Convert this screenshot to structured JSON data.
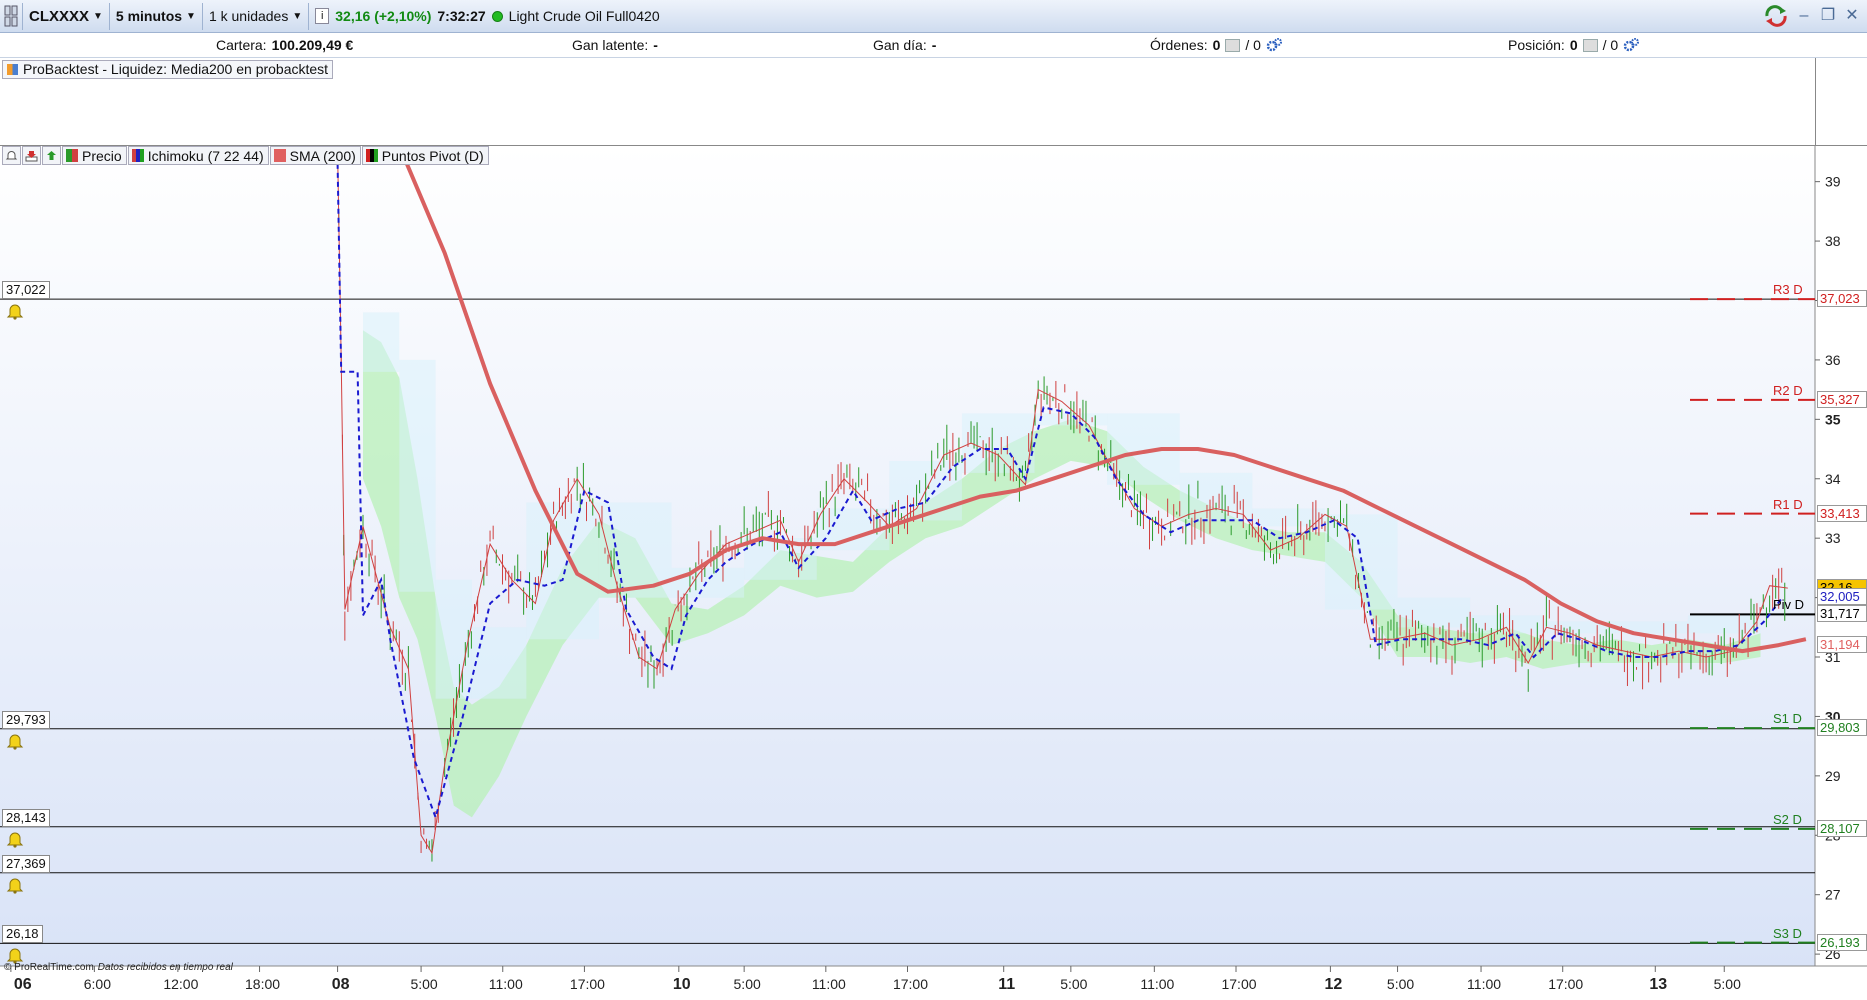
{
  "toolbar": {
    "symbol": "CLXXXX",
    "timeframe": "5 minutos",
    "units": "1 k unidades",
    "price_change": "32,16 (+2,10%)",
    "time": "7:32:27",
    "instrument": "Light Crude Oil Full0420"
  },
  "account": {
    "cartera_label": "Cartera:",
    "cartera_value": "100.209,49 €",
    "gan_latente_label": "Gan latente:",
    "gan_latente_value": "-",
    "gan_dia_label": "Gan día:",
    "gan_dia_value": "-",
    "ordenes_label": "Órdenes:",
    "ordenes_a": "0",
    "ordenes_b": "/ 0",
    "posicion_label": "Posición:",
    "posicion_a": "0",
    "posicion_b": "/ 0"
  },
  "indicator_panel": {
    "label": "ProBacktest - Liquidez: Media200 en probacktest"
  },
  "legend": {
    "items": [
      {
        "label": "Precio",
        "color": "#e06060"
      },
      {
        "label": "Ichimoku (7 22 44)",
        "color": "#2020c0"
      },
      {
        "label": "SMA (200)",
        "color": "#e06060"
      },
      {
        "label": "Puntos Pivot (D)",
        "color": "#000000"
      }
    ]
  },
  "alert_levels": [
    "37,022",
    "29,793",
    "28,143",
    "27,369",
    "26,18"
  ],
  "pivots": [
    {
      "name": "R3 D",
      "value": "37,023",
      "color": "#d02020"
    },
    {
      "name": "R2 D",
      "value": "35,327",
      "color": "#d02020"
    },
    {
      "name": "R1 D",
      "value": "33,413",
      "color": "#d02020"
    },
    {
      "name": "Piv D",
      "value": "31,717",
      "color": "#000000"
    },
    {
      "name": "S1 D",
      "value": "29,803",
      "color": "#208020"
    },
    {
      "name": "S2 D",
      "value": "28,107",
      "color": "#208020"
    },
    {
      "name": "S3 D",
      "value": "26,193",
      "color": "#208020"
    }
  ],
  "price_tags": {
    "last": "32,16",
    "kijun": "32,005",
    "sma": "31,194",
    "last_color": "#f5c400",
    "kijun_color": "#2020c0",
    "sma_color": "#e06060"
  },
  "footer": {
    "credit": "© ProRealTime.com",
    "note": "Datos recibidos en tiempo real"
  },
  "chart_data": {
    "type": "line",
    "y_ticks": [
      "39",
      "38",
      "37",
      "36",
      "35",
      "34",
      "33",
      "32",
      "31",
      "30",
      "29",
      "28",
      "27",
      "26"
    ],
    "x_ticks": [
      "06",
      "6:00",
      "12:00",
      "18:00",
      "08",
      "5:00",
      "11:00",
      "17:00",
      "10",
      "5:00",
      "11:00",
      "17:00",
      "11",
      "5:00",
      "11:00",
      "17:00",
      "12",
      "5:00",
      "11:00",
      "17:00",
      "13",
      "5:00"
    ],
    "x_bold": [
      "06",
      "08",
      "10",
      "11",
      "12",
      "13"
    ],
    "ylim": [
      25.8,
      39.6
    ],
    "price_path": [
      [
        0.186,
        39.5
      ],
      [
        0.188,
        36.0
      ],
      [
        0.19,
        31.8
      ],
      [
        0.2,
        33.2
      ],
      [
        0.215,
        31.5
      ],
      [
        0.225,
        30.8
      ],
      [
        0.232,
        28.0
      ],
      [
        0.238,
        27.7
      ],
      [
        0.245,
        29.2
      ],
      [
        0.258,
        31.3
      ],
      [
        0.27,
        32.9
      ],
      [
        0.282,
        32.3
      ],
      [
        0.295,
        31.9
      ],
      [
        0.305,
        33.3
      ],
      [
        0.318,
        34.0
      ],
      [
        0.33,
        33.4
      ],
      [
        0.34,
        32.2
      ],
      [
        0.352,
        31.0
      ],
      [
        0.362,
        30.8
      ],
      [
        0.372,
        31.8
      ],
      [
        0.385,
        32.4
      ],
      [
        0.4,
        32.9
      ],
      [
        0.415,
        33.1
      ],
      [
        0.43,
        33.3
      ],
      [
        0.44,
        32.6
      ],
      [
        0.452,
        33.4
      ],
      [
        0.465,
        34.0
      ],
      [
        0.478,
        33.6
      ],
      [
        0.49,
        33.2
      ],
      [
        0.505,
        33.5
      ],
      [
        0.52,
        34.4
      ],
      [
        0.535,
        34.6
      ],
      [
        0.55,
        34.4
      ],
      [
        0.565,
        33.9
      ],
      [
        0.572,
        35.5
      ],
      [
        0.585,
        35.3
      ],
      [
        0.6,
        34.9
      ],
      [
        0.612,
        34.2
      ],
      [
        0.625,
        33.5
      ],
      [
        0.64,
        33.2
      ],
      [
        0.655,
        33.4
      ],
      [
        0.67,
        33.5
      ],
      [
        0.685,
        33.4
      ],
      [
        0.7,
        32.8
      ],
      [
        0.715,
        33.0
      ],
      [
        0.73,
        33.4
      ],
      [
        0.742,
        33.2
      ],
      [
        0.755,
        31.3
      ],
      [
        0.768,
        31.3
      ],
      [
        0.785,
        31.4
      ],
      [
        0.8,
        31.2
      ],
      [
        0.815,
        31.3
      ],
      [
        0.83,
        31.5
      ],
      [
        0.842,
        30.9
      ],
      [
        0.852,
        31.5
      ],
      [
        0.865,
        31.4
      ],
      [
        0.88,
        31.2
      ],
      [
        0.895,
        31.1
      ],
      [
        0.91,
        31.0
      ],
      [
        0.925,
        31.1
      ],
      [
        0.94,
        31.0
      ],
      [
        0.955,
        31.1
      ],
      [
        0.968,
        31.6
      ],
      [
        0.975,
        32.2
      ],
      [
        0.985,
        32.16
      ]
    ],
    "kijun_path": [
      [
        0.186,
        39.3
      ],
      [
        0.188,
        35.8
      ],
      [
        0.197,
        35.8
      ],
      [
        0.2,
        31.7
      ],
      [
        0.21,
        32.3
      ],
      [
        0.215,
        31.3
      ],
      [
        0.228,
        29.3
      ],
      [
        0.24,
        28.3
      ],
      [
        0.255,
        30.0
      ],
      [
        0.27,
        31.9
      ],
      [
        0.285,
        32.3
      ],
      [
        0.3,
        32.2
      ],
      [
        0.31,
        32.3
      ],
      [
        0.322,
        33.8
      ],
      [
        0.335,
        33.6
      ],
      [
        0.345,
        31.8
      ],
      [
        0.36,
        31.0
      ],
      [
        0.37,
        30.8
      ],
      [
        0.378,
        31.7
      ],
      [
        0.39,
        32.3
      ],
      [
        0.4,
        32.6
      ],
      [
        0.415,
        32.9
      ],
      [
        0.43,
        33.1
      ],
      [
        0.44,
        32.5
      ],
      [
        0.455,
        33.0
      ],
      [
        0.47,
        33.8
      ],
      [
        0.48,
        33.3
      ],
      [
        0.495,
        33.5
      ],
      [
        0.51,
        33.6
      ],
      [
        0.525,
        34.2
      ],
      [
        0.54,
        34.5
      ],
      [
        0.555,
        34.5
      ],
      [
        0.565,
        34.0
      ],
      [
        0.575,
        35.2
      ],
      [
        0.59,
        35.1
      ],
      [
        0.603,
        34.7
      ],
      [
        0.615,
        34.0
      ],
      [
        0.63,
        33.4
      ],
      [
        0.645,
        33.1
      ],
      [
        0.66,
        33.3
      ],
      [
        0.675,
        33.3
      ],
      [
        0.69,
        33.3
      ],
      [
        0.705,
        33.0
      ],
      [
        0.72,
        33.1
      ],
      [
        0.735,
        33.3
      ],
      [
        0.748,
        33.0
      ],
      [
        0.758,
        31.2
      ],
      [
        0.772,
        31.3
      ],
      [
        0.79,
        31.3
      ],
      [
        0.805,
        31.3
      ],
      [
        0.82,
        31.2
      ],
      [
        0.835,
        31.4
      ],
      [
        0.845,
        31.0
      ],
      [
        0.858,
        31.4
      ],
      [
        0.87,
        31.3
      ],
      [
        0.885,
        31.1
      ],
      [
        0.9,
        31.0
      ],
      [
        0.915,
        31.0
      ],
      [
        0.93,
        31.1
      ],
      [
        0.945,
        31.1
      ],
      [
        0.958,
        31.2
      ],
      [
        0.972,
        31.6
      ],
      [
        0.982,
        32.0
      ]
    ],
    "sma_path": [
      [
        0.22,
        39.6
      ],
      [
        0.245,
        37.8
      ],
      [
        0.27,
        35.6
      ],
      [
        0.295,
        33.8
      ],
      [
        0.318,
        32.4
      ],
      [
        0.335,
        32.1
      ],
      [
        0.36,
        32.2
      ],
      [
        0.38,
        32.4
      ],
      [
        0.4,
        32.8
      ],
      [
        0.42,
        33.0
      ],
      [
        0.44,
        32.9
      ],
      [
        0.46,
        32.9
      ],
      [
        0.48,
        33.1
      ],
      [
        0.5,
        33.3
      ],
      [
        0.52,
        33.5
      ],
      [
        0.54,
        33.7
      ],
      [
        0.56,
        33.8
      ],
      [
        0.58,
        34.0
      ],
      [
        0.6,
        34.2
      ],
      [
        0.62,
        34.4
      ],
      [
        0.64,
        34.5
      ],
      [
        0.66,
        34.5
      ],
      [
        0.68,
        34.4
      ],
      [
        0.7,
        34.2
      ],
      [
        0.72,
        34.0
      ],
      [
        0.74,
        33.8
      ],
      [
        0.76,
        33.5
      ],
      [
        0.78,
        33.2
      ],
      [
        0.8,
        32.9
      ],
      [
        0.82,
        32.6
      ],
      [
        0.84,
        32.3
      ],
      [
        0.86,
        31.9
      ],
      [
        0.88,
        31.6
      ],
      [
        0.9,
        31.4
      ],
      [
        0.92,
        31.3
      ],
      [
        0.94,
        31.2
      ],
      [
        0.96,
        31.1
      ],
      [
        0.98,
        31.2
      ],
      [
        0.995,
        31.3
      ]
    ],
    "cloud_path": [
      [
        0.2,
        36.5
      ],
      [
        0.21,
        36.3
      ],
      [
        0.22,
        35.7
      ],
      [
        0.23,
        34.0
      ],
      [
        0.24,
        32.0
      ],
      [
        0.25,
        30.5
      ],
      [
        0.26,
        30.2
      ],
      [
        0.275,
        30.5
      ],
      [
        0.29,
        31.2
      ],
      [
        0.31,
        32.5
      ],
      [
        0.33,
        33.3
      ],
      [
        0.35,
        33.0
      ],
      [
        0.37,
        31.9
      ],
      [
        0.39,
        31.8
      ],
      [
        0.41,
        32.2
      ],
      [
        0.43,
        32.8
      ],
      [
        0.45,
        32.7
      ],
      [
        0.47,
        32.6
      ],
      [
        0.49,
        33.2
      ],
      [
        0.51,
        33.6
      ],
      [
        0.53,
        34.0
      ],
      [
        0.55,
        34.5
      ],
      [
        0.57,
        34.8
      ],
      [
        0.59,
        35.0
      ],
      [
        0.61,
        34.8
      ],
      [
        0.63,
        34.2
      ],
      [
        0.65,
        33.8
      ],
      [
        0.67,
        33.5
      ],
      [
        0.69,
        33.2
      ],
      [
        0.71,
        33.1
      ],
      [
        0.73,
        33.1
      ],
      [
        0.75,
        32.6
      ],
      [
        0.77,
        31.7
      ],
      [
        0.79,
        31.5
      ],
      [
        0.81,
        31.4
      ],
      [
        0.83,
        31.5
      ],
      [
        0.85,
        31.3
      ],
      [
        0.87,
        31.2
      ],
      [
        0.89,
        31.3
      ],
      [
        0.91,
        31.2
      ],
      [
        0.93,
        31.3
      ],
      [
        0.95,
        31.2
      ],
      [
        0.97,
        31.4
      ]
    ],
    "cloud_bottom": [
      [
        0.2,
        34.0
      ],
      [
        0.21,
        33.2
      ],
      [
        0.22,
        32.0
      ],
      [
        0.23,
        31.3
      ],
      [
        0.24,
        30.0
      ],
      [
        0.25,
        28.5
      ],
      [
        0.26,
        28.3
      ],
      [
        0.275,
        29.0
      ],
      [
        0.29,
        30.0
      ],
      [
        0.31,
        31.2
      ],
      [
        0.33,
        32.0
      ],
      [
        0.35,
        32.0
      ],
      [
        0.37,
        31.2
      ],
      [
        0.39,
        31.4
      ],
      [
        0.41,
        31.7
      ],
      [
        0.43,
        32.2
      ],
      [
        0.45,
        32.0
      ],
      [
        0.47,
        32.1
      ],
      [
        0.49,
        32.6
      ],
      [
        0.51,
        33.0
      ],
      [
        0.53,
        33.2
      ],
      [
        0.55,
        33.6
      ],
      [
        0.57,
        34.0
      ],
      [
        0.59,
        34.3
      ],
      [
        0.61,
        34.2
      ],
      [
        0.63,
        33.7
      ],
      [
        0.65,
        33.3
      ],
      [
        0.67,
        33.0
      ],
      [
        0.69,
        32.8
      ],
      [
        0.71,
        32.7
      ],
      [
        0.73,
        32.6
      ],
      [
        0.75,
        32.0
      ],
      [
        0.77,
        31.0
      ],
      [
        0.79,
        31.0
      ],
      [
        0.81,
        30.9
      ],
      [
        0.83,
        31.0
      ],
      [
        0.85,
        30.8
      ],
      [
        0.87,
        30.9
      ],
      [
        0.89,
        30.9
      ],
      [
        0.91,
        30.9
      ],
      [
        0.93,
        30.9
      ],
      [
        0.95,
        30.9
      ],
      [
        0.97,
        31.0
      ]
    ]
  }
}
